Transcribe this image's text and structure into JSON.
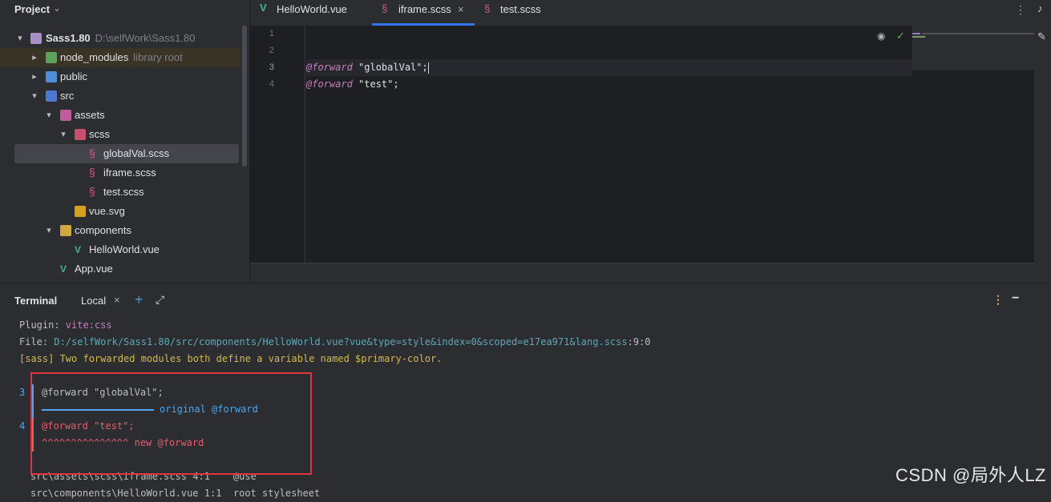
{
  "project": {
    "title": "Project",
    "tree": [
      {
        "label": "Sass1.80",
        "sub": "D:\\selfWork\\Sass1.80"
      },
      {
        "label": "node_modules",
        "sub": "library root"
      },
      {
        "label": "public"
      },
      {
        "label": "src"
      },
      {
        "label": "assets"
      },
      {
        "label": "scss"
      },
      {
        "label": "globalVal.scss"
      },
      {
        "label": "iframe.scss"
      },
      {
        "label": "test.scss"
      },
      {
        "label": "vue.svg"
      },
      {
        "label": "components"
      },
      {
        "label": "HelloWorld.vue"
      },
      {
        "label": "App.vue"
      }
    ]
  },
  "editor": {
    "tabs": [
      {
        "label": "HelloWorld.vue"
      },
      {
        "label": "iframe.scss",
        "close": "×"
      },
      {
        "label": "test.scss"
      }
    ],
    "line_numbers": [
      "1",
      "2",
      "3",
      "4"
    ],
    "lines": [
      {
        "kw": "",
        "str": ""
      },
      {
        "kw": "",
        "str": ""
      },
      {
        "kw": "@forward",
        "str": "\"globalVal\"",
        "end": ";"
      },
      {
        "kw": "@forward",
        "str": "\"test\"",
        "end": ";"
      }
    ]
  },
  "terminal": {
    "title": "Terminal",
    "tab": "Local",
    "tab_close": "×",
    "plugin_label": "Plugin: ",
    "plugin_value": "vite:css",
    "file_label": "File: ",
    "file_path": "D:/selfWork/Sass1.80/src/components/HelloWorld.vue?vue&type=style&index=0&scoped=e17ea971&lang.scss",
    "file_pos": ":9:0",
    "error_msg": "[sass] Two forwarded modules both define a variable named $primary-color.",
    "snippet": {
      "bar_top": "╷",
      "ln3": "3",
      "code3": "@forward \"globalVal\";",
      "note3": "original @forward",
      "ln4": "4",
      "code4": "@forward \"test\";",
      "marker4": "^^^^^^^^^^^^^^^ new @forward",
      "bar_bottom": "╵"
    },
    "trace": [
      {
        "file": "src\\assets\\scss\\iframe.scss 4:1",
        "what": "@use"
      },
      {
        "file": "src\\components\\HelloWorld.vue 1:1",
        "what": "root stylesheet"
      }
    ]
  },
  "watermark": "CSDN @局外人LZ"
}
